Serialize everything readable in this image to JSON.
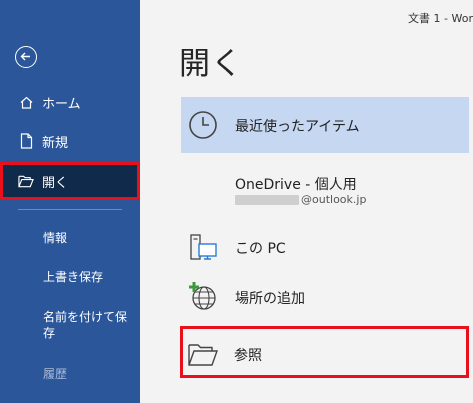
{
  "window": {
    "title": "文書 1  -  Wor"
  },
  "sidebar": {
    "back_icon": "back-arrow-icon",
    "items": [
      {
        "label": "ホーム",
        "icon": "home-icon"
      },
      {
        "label": "新規",
        "icon": "new-document-icon"
      },
      {
        "label": "開く",
        "icon": "open-folder-icon",
        "selected": true
      }
    ],
    "sub_items": [
      {
        "label": "情報"
      },
      {
        "label": "上書き保存"
      },
      {
        "label": "名前を付けて保存"
      },
      {
        "label": "履歴",
        "disabled": true
      }
    ]
  },
  "main": {
    "title": "開く",
    "locations": [
      {
        "label": "最近使ったアイテム",
        "icon": "clock-icon",
        "selected": true
      },
      {
        "label": "OneDrive - 個人用",
        "sublabel_suffix": "@outlook.jp",
        "icon": "onedrive-icon"
      },
      {
        "label": "この PC",
        "icon": "this-pc-icon"
      },
      {
        "label": "場所の追加",
        "icon": "add-place-icon"
      },
      {
        "label": "参照",
        "icon": "browse-folder-icon",
        "highlighted": true
      }
    ]
  },
  "colors": {
    "sidebar": "#2b579a",
    "sidebar_selected": "#102a4c",
    "highlight_border": "#e8101a",
    "recent_bg": "#c5d7f1"
  }
}
